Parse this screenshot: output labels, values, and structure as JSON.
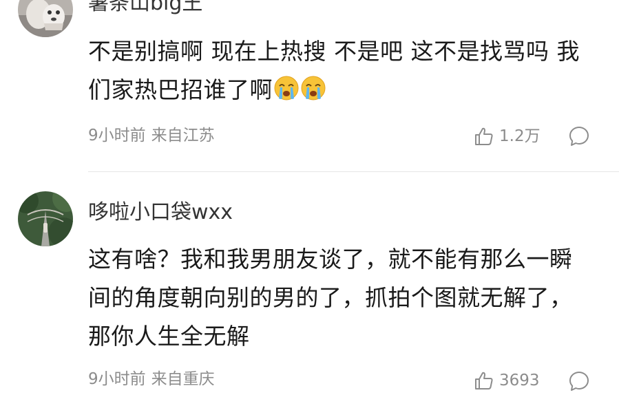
{
  "comments": [
    {
      "username": "薯条山big王",
      "text": "不是别搞啊 现在上热搜 不是吧 这不是找骂吗 我们家热巴招谁了啊",
      "emoji": [
        "loudly-crying-face",
        "loudly-crying-face"
      ],
      "time": "9小时前",
      "location": "来自江苏",
      "likes": "1.2万"
    },
    {
      "username": "哆啦小口袋wxx",
      "text": "这有啥？我和我男朋友谈了，就不能有那么一瞬间的角度朝向别的男的了，抓拍个图就无解了，那你人生全无解",
      "time": "9小时前",
      "location": "来自重庆",
      "likes": "3693"
    }
  ],
  "colors": {
    "text": "#1a1a1a",
    "meta": "#8c8c8c",
    "divider": "#e6e6e6"
  }
}
